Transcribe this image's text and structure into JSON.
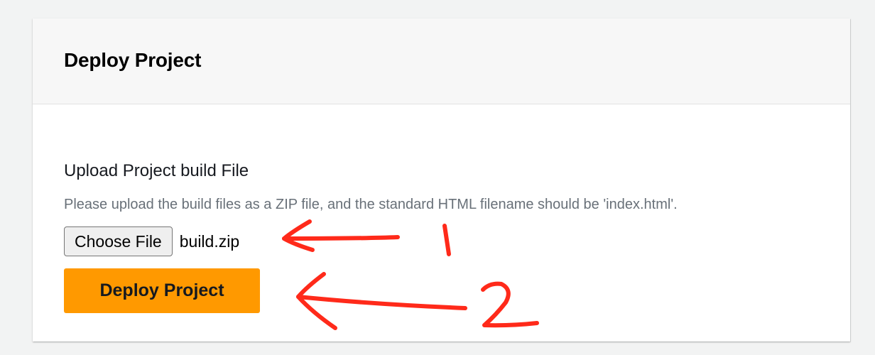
{
  "card": {
    "title": "Deploy Project",
    "field_label": "Upload Project build File",
    "field_description": "Please upload the build files as a ZIP file, and the standard HTML filename should be 'index.html'.",
    "choose_file_label": "Choose File",
    "selected_file": "build.zip",
    "deploy_button_label": "Deploy Project"
  },
  "colors": {
    "accent": "#ff9900",
    "annotation": "#ff2a1a"
  },
  "annotations": {
    "marker_1": "1",
    "marker_2": "2"
  }
}
